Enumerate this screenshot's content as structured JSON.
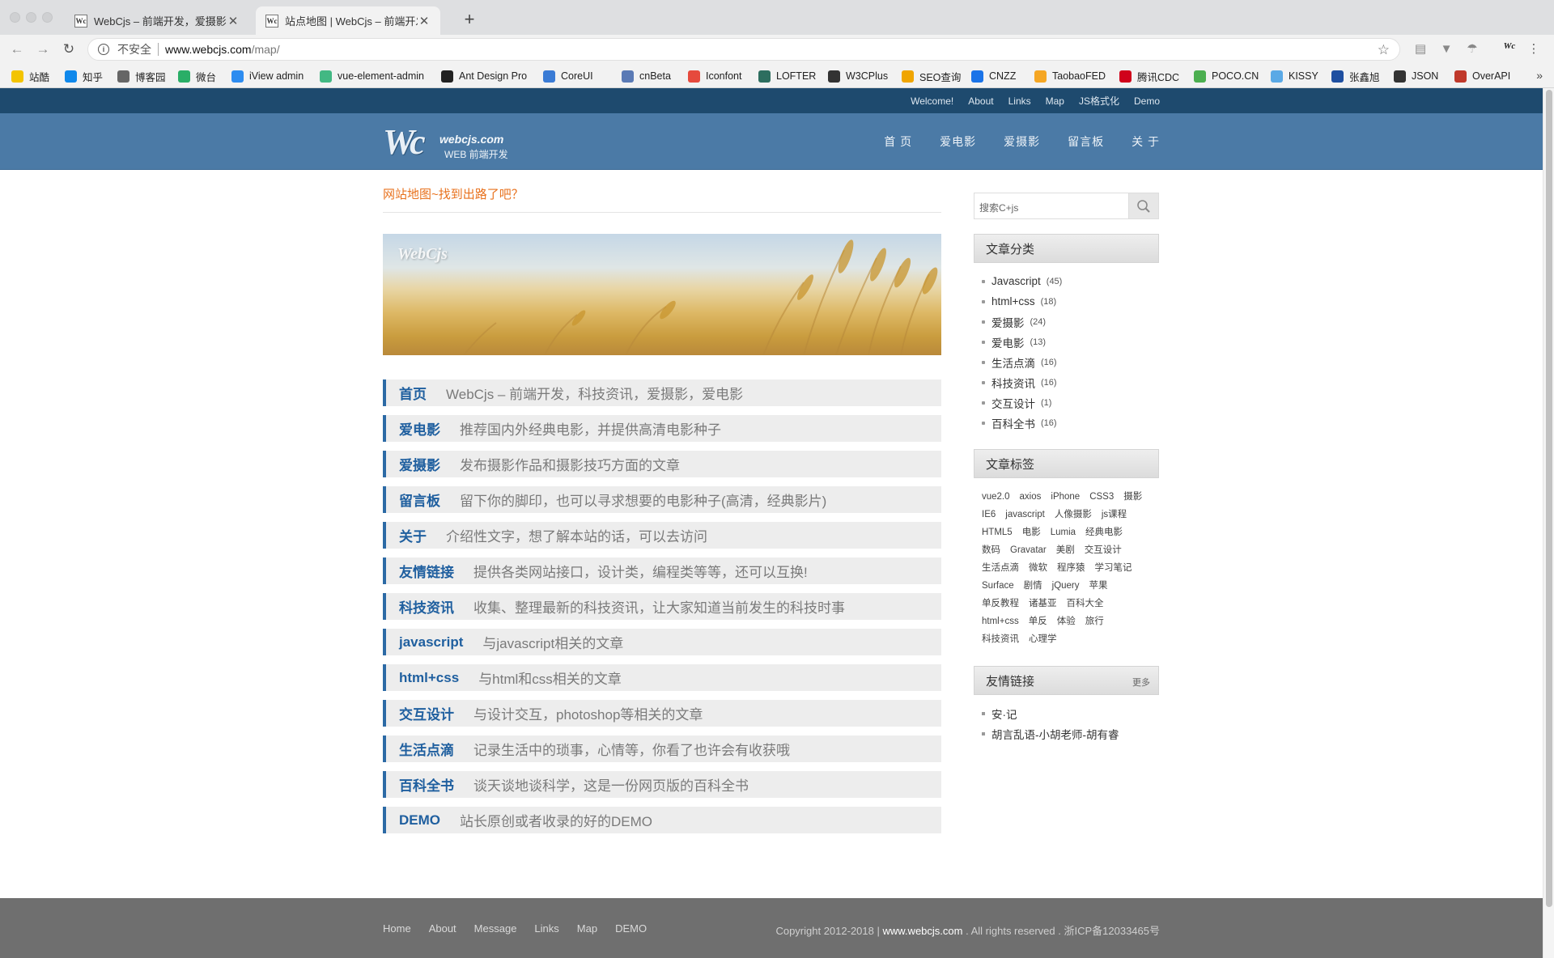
{
  "browser": {
    "tabs": [
      {
        "label": "WebCjs – 前端开发，爱摄影，爱",
        "favicon": "Wc"
      },
      {
        "label": "站点地图 | WebCjs – 前端开发，",
        "favicon": "Wc"
      }
    ],
    "security_label": "不安全",
    "url_host": "www.webcjs.com",
    "url_path": "/map/",
    "bookmarks": [
      {
        "label": "站酷",
        "icon": "zcool-icon",
        "color": "#f3c400"
      },
      {
        "label": "知乎",
        "icon": "zhihu-icon",
        "color": "#0f88eb"
      },
      {
        "label": "博客园",
        "icon": "cnblogs-icon",
        "color": "#666666"
      },
      {
        "label": "微台",
        "icon": "wechat-icon",
        "color": "#2aae67"
      },
      {
        "label": "iView admin",
        "icon": "iview-icon",
        "color": "#2d8cf0"
      },
      {
        "label": "vue-element-admin",
        "icon": "vue-icon",
        "color": "#42b883"
      },
      {
        "label": "Ant Design Pro",
        "icon": "antd-icon",
        "color": "#222222"
      },
      {
        "label": "CoreUI",
        "icon": "coreui-icon",
        "color": "#3a7bd5"
      },
      {
        "label": "cnBeta",
        "icon": "cnbeta-icon",
        "color": "#5a7ab5"
      },
      {
        "label": "Iconfont",
        "icon": "iconfont-icon",
        "color": "#e64a3d"
      },
      {
        "label": "LOFTER",
        "icon": "lofter-icon",
        "color": "#2d6e5f"
      },
      {
        "label": "W3CPlus",
        "icon": "w3cplus-icon",
        "color": "#333333"
      },
      {
        "label": "SEO查询",
        "icon": "seo-icon",
        "color": "#f0a500"
      },
      {
        "label": "CNZZ",
        "icon": "cnzz-icon",
        "color": "#1a73e8"
      },
      {
        "label": "TaobaoFED",
        "icon": "taobao-icon",
        "color": "#f5a623"
      },
      {
        "label": "腾讯CDC",
        "icon": "cdc-icon",
        "color": "#d0021b"
      },
      {
        "label": "POCO.CN",
        "icon": "poco-icon",
        "color": "#4caf50"
      },
      {
        "label": "KISSY",
        "icon": "kissy-icon",
        "color": "#5aa9e6"
      },
      {
        "label": "张鑫旭",
        "icon": "zxx-icon",
        "color": "#1f4fa0"
      },
      {
        "label": "JSON",
        "icon": "json-icon",
        "color": "#333333"
      },
      {
        "label": "OverAPI",
        "icon": "overapi-icon",
        "color": "#c0392b"
      }
    ],
    "bookmarks_overflow": "»"
  },
  "site": {
    "top_links": [
      "Welcome!",
      "About",
      "Links",
      "Map",
      "JS格式化",
      "Demo"
    ],
    "logo_domain": "webcjs.com",
    "logo_sub": "WEB 前端开发",
    "logo_mark": "Wc",
    "nav": [
      "首 页",
      "爱电影",
      "爱摄影",
      "留言板",
      "关 于"
    ],
    "page_title": "网站地图~找到出路了吧？",
    "banner_watermark": "WebCjs",
    "map_items": [
      {
        "name": "首页",
        "desc": "WebCjs – 前端开发，科技资讯，爱摄影，爱电影"
      },
      {
        "name": "爱电影",
        "desc": "推荐国内外经典电影，并提供高清电影种子"
      },
      {
        "name": "爱摄影",
        "desc": "发布摄影作品和摄影技巧方面的文章"
      },
      {
        "name": "留言板",
        "desc": "留下你的脚印，也可以寻求想要的电影种子(高清，经典影片)"
      },
      {
        "name": "关于",
        "desc": "介绍性文字，想了解本站的话，可以去访问"
      },
      {
        "name": "友情链接",
        "desc": "提供各类网站接口，设计类，编程类等等，还可以互换!"
      },
      {
        "name": "科技资讯",
        "desc": "收集、整理最新的科技资讯，让大家知道当前发生的科技时事"
      },
      {
        "name": "javascript",
        "desc": "与javascript相关的文章"
      },
      {
        "name": "html+css",
        "desc": "与html和css相关的文章"
      },
      {
        "name": "交互设计",
        "desc": "与设计交互，photoshop等相关的文章"
      },
      {
        "name": "生活点滴",
        "desc": "记录生活中的琐事，心情等，你看了也许会有收获哦"
      },
      {
        "name": "百科全书",
        "desc": "谈天谈地谈科学，这是一份网页版的百科全书"
      },
      {
        "name": "DEMO",
        "desc": "站长原创或者收录的好的DEMO"
      }
    ],
    "search_placeholder": "搜索C+js",
    "categories_title": "文章分类",
    "categories": [
      {
        "name": "Javascript",
        "count": "(45)"
      },
      {
        "name": "html+css",
        "count": "(18)"
      },
      {
        "name": "爱摄影",
        "count": "(24)"
      },
      {
        "name": "爱电影",
        "count": "(13)"
      },
      {
        "name": "生活点滴",
        "count": "(16)"
      },
      {
        "name": "科技资讯",
        "count": "(16)"
      },
      {
        "name": "交互设计",
        "count": "(1)"
      },
      {
        "name": "百科全书",
        "count": "(16)"
      }
    ],
    "tags_title": "文章标签",
    "tags": [
      "vue2.0",
      "axios",
      "iPhone",
      "CSS3",
      "摄影",
      "IE6",
      "javascript",
      "人像摄影",
      "js课程",
      "HTML5",
      "电影",
      "Lumia",
      "经典电影",
      "数码",
      "Gravatar",
      "美剧",
      "交互设计",
      "生活点滴",
      "微软",
      "程序猿",
      "学习笔记",
      "Surface",
      "剧情",
      "jQuery",
      "苹果",
      "单反教程",
      "诸基亚",
      "百科大全",
      "html+css",
      "单反",
      "体验",
      "旅行",
      "科技资讯",
      "心理学"
    ],
    "links_title": "友情链接",
    "links_more": "更多",
    "friend_links": [
      "安·记",
      "胡言乱语-小胡老师-胡有睿"
    ],
    "footer_nav": [
      "Home",
      "About",
      "Message",
      "Links",
      "Map",
      "DEMO"
    ],
    "copyright_pre": "Copyright 2012-2018 |",
    "copyright_site": "www.webcjs.com",
    "copyright_post": ". All rights reserved . 浙ICP备12033465号"
  }
}
